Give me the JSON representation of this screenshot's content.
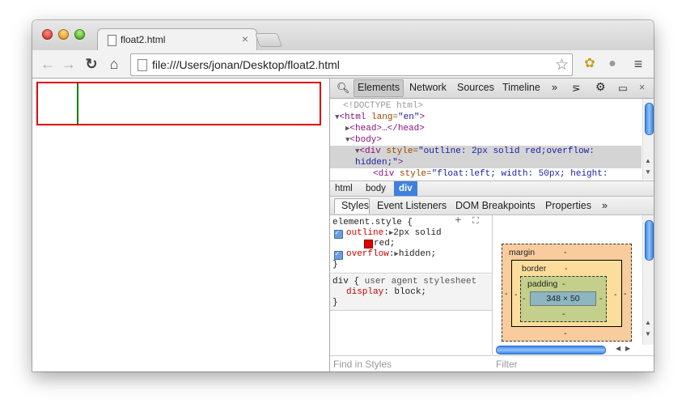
{
  "browser": {
    "tab_title": "float2.html",
    "tab_close": "×",
    "url": "file:///Users/jonan/Desktop/float2.html"
  },
  "devtools": {
    "tabs": [
      "Elements",
      "Network",
      "Sources",
      "Timeline"
    ],
    "more": "»",
    "close": "×",
    "dom_lines": {
      "doctype": "<!DOCTYPE html>",
      "html_open": "<html",
      "html_attr": " lang=",
      "html_val": "\"en\"",
      "html_close": ">",
      "head": "<head>…</head>",
      "body": "<body>",
      "div1_tag": "<div",
      "div1_attr": " style=",
      "div1_val": "\"outline: 2px solid red;overflow:",
      "div1_val2": "hidden;\"",
      "div1_close": ">",
      "div2_tag": "<div",
      "div2_attr": " style=",
      "div2_val": "\"float:left; width: 50px; height:"
    },
    "breadcrumbs": [
      "html",
      "body",
      "div"
    ],
    "side_tabs": [
      "Styles",
      "Event Listeners",
      "DOM Breakpoints",
      "Properties"
    ],
    "side_more": "»",
    "styles": {
      "element_style": "element.style {",
      "outline_prop": "outline",
      "outline_val": "2px solid",
      "outline_color": "red;",
      "overflow_prop": "overflow",
      "overflow_val": "hidden;",
      "close_brace": "}",
      "div_selector": "div {",
      "ua_label": "user agent stylesheet",
      "display_prop": "display",
      "display_val": "block;",
      "close_brace2": "}"
    },
    "metrics": {
      "margin_label": "margin",
      "border_label": "border",
      "padding_label": "padding",
      "dash": "-",
      "content_size": "348 × 50"
    },
    "find_placeholder": "Find in Styles",
    "filter_placeholder": "Filter"
  },
  "colors": {
    "outline": "#e00000",
    "float_border": "#008000",
    "selected_crumb": "#3f7fe0"
  }
}
